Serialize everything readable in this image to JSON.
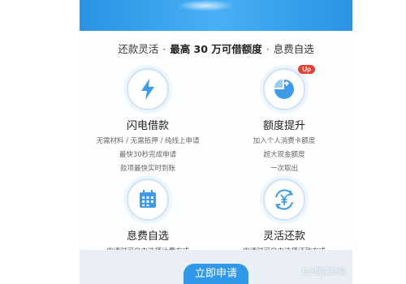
{
  "tagline": {
    "part1": "还款灵活",
    "dot": "·",
    "part2": "最高 30 万可借额度",
    "part3": "息费自选"
  },
  "features": [
    {
      "title": "闪电借款",
      "icon": "lightning-icon",
      "lines": [
        "无需材料 / 无需抵押 / 纯线上申请",
        "最快30秒完成申请",
        "款项最快实时到账"
      ]
    },
    {
      "title": "额度提升",
      "icon": "pie-chart-up-icon",
      "badge": "Up",
      "lines": [
        "加入个人消费卡额度",
        "超大现金额度",
        "一次取出"
      ]
    },
    {
      "title": "息费自选",
      "icon": "calendar-icon",
      "lines": [
        "申请时可自由选择计费方式"
      ]
    },
    {
      "title": "灵活还款",
      "icon": "yen-cycle-icon",
      "lines": [
        "申请时可自由选择还款方式"
      ]
    }
  ],
  "apply_button": "立即申请",
  "watermark": "Bai百度经验",
  "colors": {
    "accent": "#2f98e8",
    "icon_blue": "#3d9be9",
    "badge_red": "#e8402f"
  }
}
